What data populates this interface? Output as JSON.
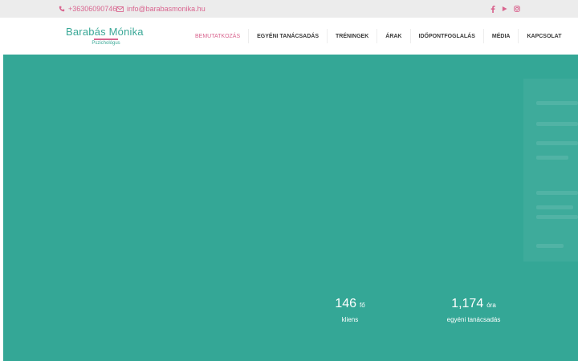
{
  "topbar": {
    "phone": "+36306090746",
    "email": "info@barabasmonika.hu",
    "social": [
      "facebook-icon",
      "youtube-icon",
      "instagram-icon"
    ]
  },
  "logo": {
    "name": "Barabás Mónika",
    "subtitle": "Pszichológus"
  },
  "nav": {
    "items": [
      {
        "label": "BEMUTATKOZÁS",
        "active": true
      },
      {
        "label": "EGYÉNI TANÁCSADÁS",
        "active": false
      },
      {
        "label": "TRÉNINGEK",
        "active": false
      },
      {
        "label": "ÁRAK",
        "active": false
      },
      {
        "label": "IDŐPONTFOGLALÁS",
        "active": false
      },
      {
        "label": "MÉDIA",
        "active": false
      },
      {
        "label": "KAPCSOLAT",
        "active": false
      }
    ]
  },
  "stats": [
    {
      "number": "146",
      "unit": "fő",
      "label": "kliens"
    },
    {
      "number": "1,174",
      "unit": "óra",
      "label": "egyéni tanácsadás"
    }
  ],
  "colors": {
    "accent": "#d9658f",
    "brand": "#3aa897",
    "hero": "#34a796",
    "topbar": "#ececec"
  }
}
